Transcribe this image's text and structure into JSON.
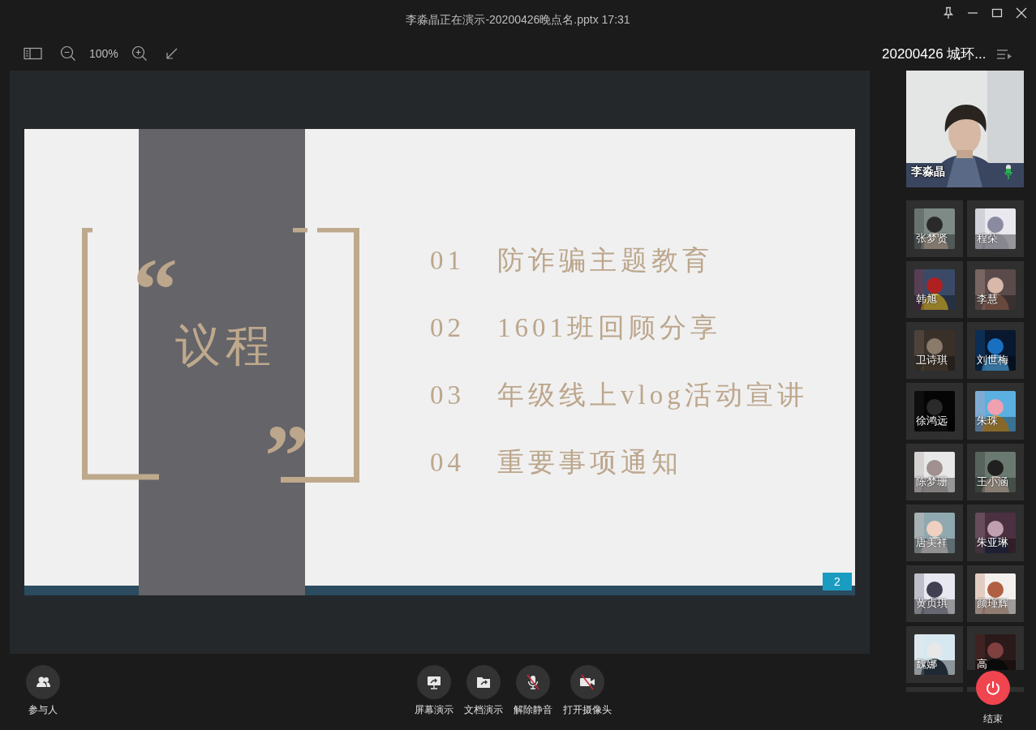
{
  "window": {
    "title": "李淼晶正在演示-20200426晚点名.pptx 17:31"
  },
  "toolbar": {
    "zoom": "100%"
  },
  "slide": {
    "heading": "议程",
    "open_quote": "“",
    "close_quote": "”",
    "page": "2",
    "agenda": [
      {
        "number": "01",
        "title": "防诈骗主题教育"
      },
      {
        "number": "02",
        "title": "1601班回顾分享"
      },
      {
        "number": "03",
        "title": "年级线上vlog活动宣讲"
      },
      {
        "number": "04",
        "title": "重要事项通知"
      }
    ]
  },
  "meeting": {
    "title": "20200426 城环...",
    "presenter": {
      "name": "李淼晶",
      "kind": "picture"
    }
  },
  "participants": [
    {
      "name": "张梦贤"
    },
    {
      "name": "程朵"
    },
    {
      "name": "韩旭"
    },
    {
      "name": "李慧"
    },
    {
      "name": "卫诗琪"
    },
    {
      "name": "刘世梅"
    },
    {
      "name": "徐鸿远"
    },
    {
      "name": "朱珠"
    },
    {
      "name": "陈梦珊"
    },
    {
      "name": "王小涵"
    },
    {
      "name": "唐美祥"
    },
    {
      "name": "朱亚琳"
    },
    {
      "name": "黄贞琪"
    },
    {
      "name": "颜瑾辉"
    },
    {
      "name": "魏娜"
    },
    {
      "name": "高"
    }
  ],
  "controls": [
    {
      "kind": "participants",
      "label": "参与人"
    },
    {
      "kind": "screen",
      "label": "屏幕演示"
    },
    {
      "kind": "document",
      "label": "文档演示"
    },
    {
      "kind": "mic",
      "label": "解除静音",
      "off": true
    },
    {
      "kind": "camera",
      "label": "打开摄像头",
      "off": true
    },
    {
      "kind": "end",
      "label": "结束"
    }
  ]
}
